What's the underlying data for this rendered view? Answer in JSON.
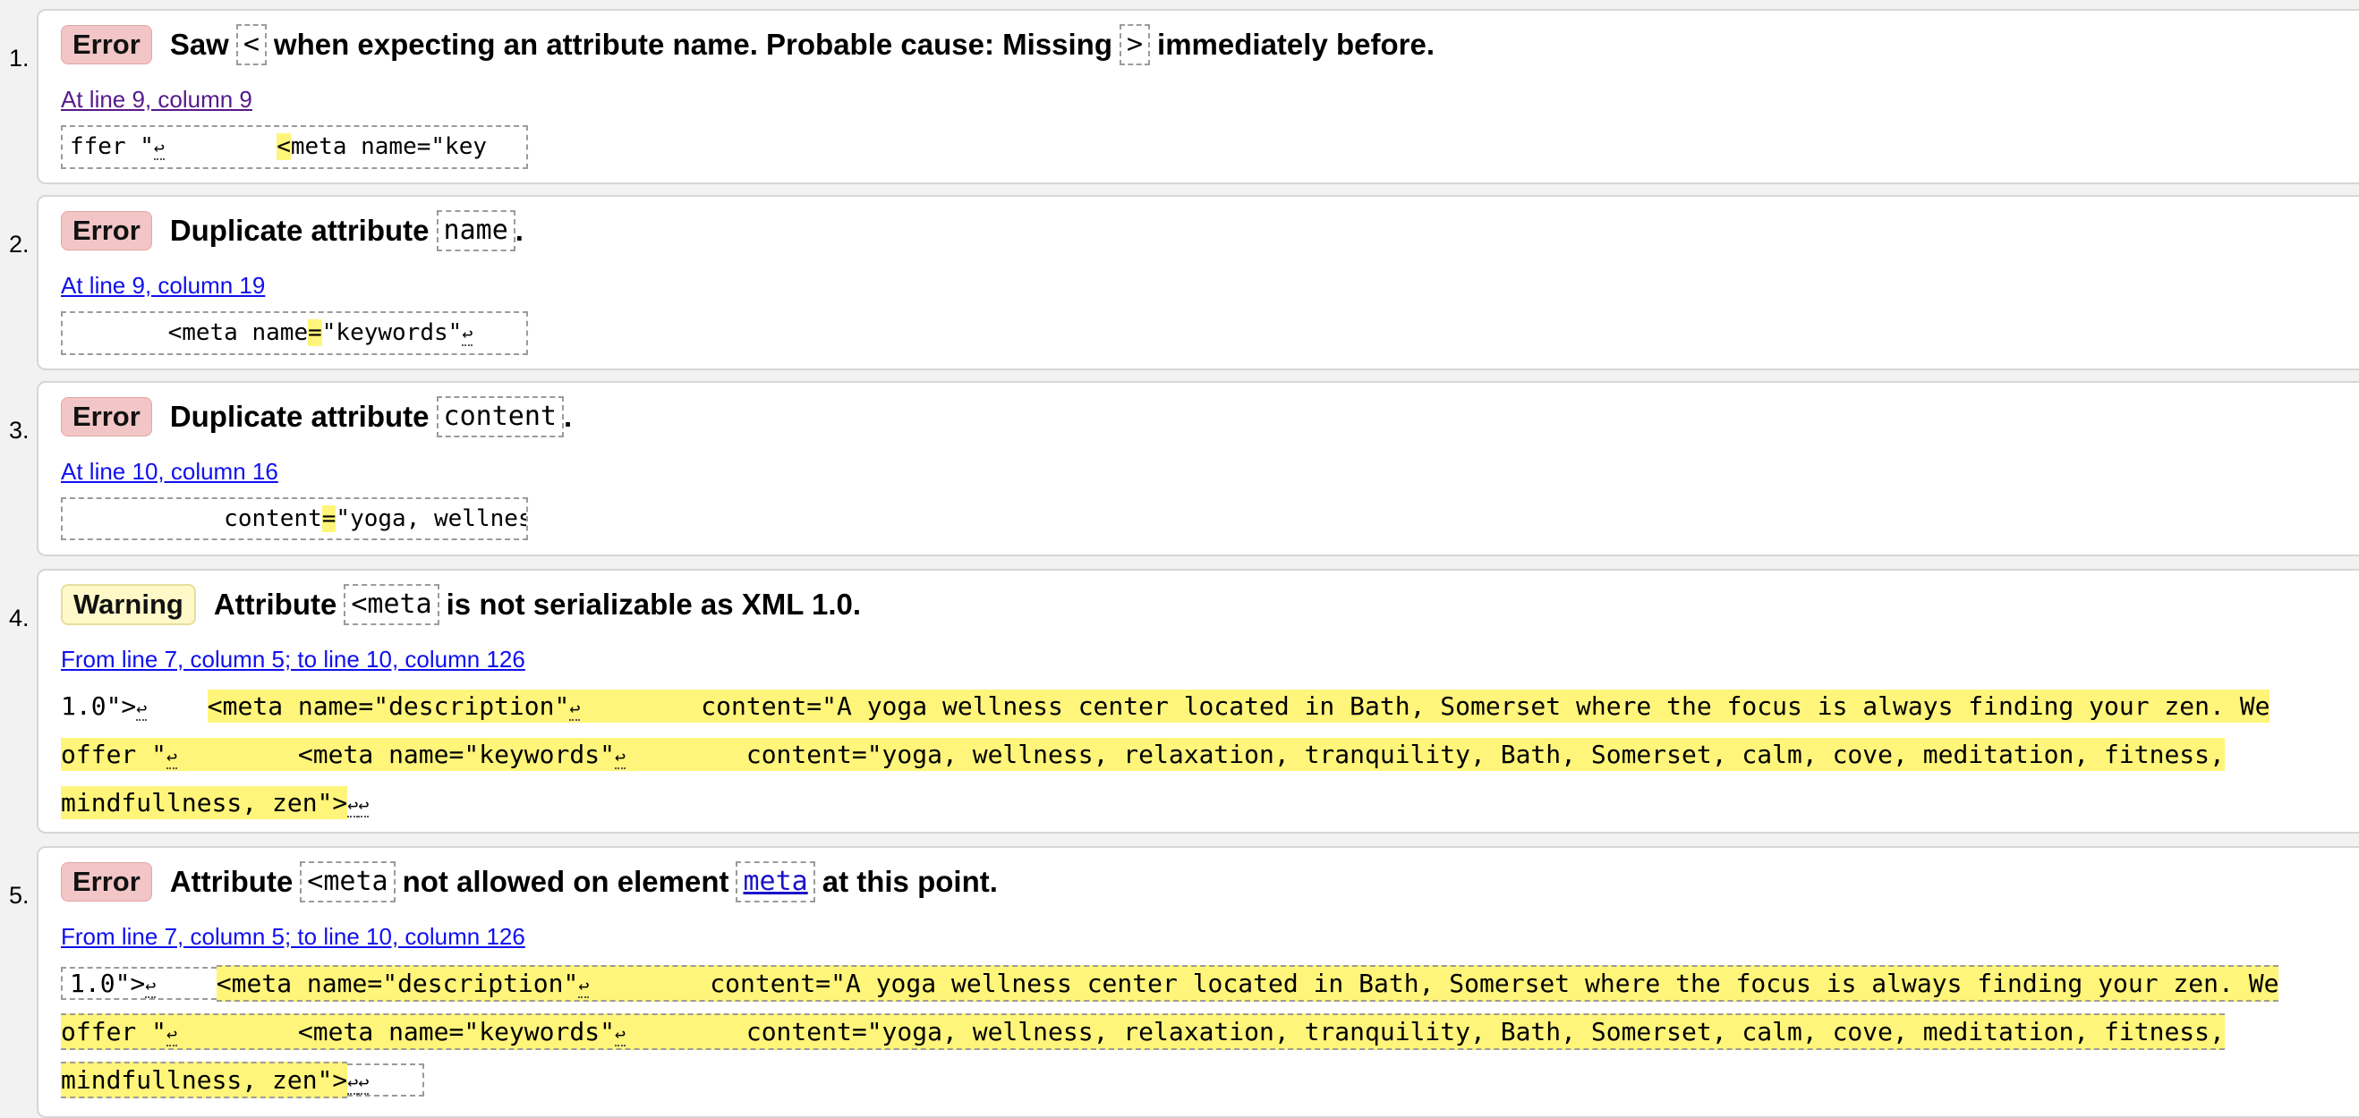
{
  "messages": [
    {
      "num": "1.",
      "type_label": "Error",
      "text_a": "Saw",
      "code_a": "<",
      "text_b": "when expecting an attribute name. Probable cause: Missing",
      "code_b": ">",
      "text_c": "immediately before.",
      "location": "At line 9, column 9",
      "extract_pre": "ffer \"",
      "extract_mid": "        ",
      "extract_hl": "<",
      "extract_post": "meta name=\"key"
    },
    {
      "num": "2.",
      "type_label": "Error",
      "text_a": "Duplicate attribute",
      "code_a": "name",
      "text_b": ".",
      "location": "At line 9, column 19",
      "extract_pre": "       <meta name",
      "extract_hl": "=",
      "extract_post": "\"keywords\""
    },
    {
      "num": "3.",
      "type_label": "Error",
      "text_a": "Duplicate attribute",
      "code_a": "content",
      "text_b": ".",
      "location": "At line 10, column 16",
      "extract_pre": "           content",
      "extract_hl": "=",
      "extract_post": "\"yoga, wellnes"
    },
    {
      "num": "4.",
      "type_label": "Warning",
      "text_a": "Attribute",
      "code_a": "<meta",
      "text_b": "is not serializable as XML 1.0.",
      "location": "From line 7, column 5; to line 10, column 126",
      "line1_pre": "1.0\">",
      "line1_hl": "<meta name=\"description\"",
      "line1_hl2": "        content=\"A yoga wellness center located in Bath, Somerset where the focus is always finding your zen. We",
      "line2_hl": "offer \"",
      "line2_hl2": "        <meta name=\"keywords\"",
      "line2_hl3": "        content=\"yoga, wellness, relaxation, tranquility, Bath, Somerset, calm, cove, meditation, fitness,",
      "line3_hl": "mindfullness, zen\">"
    },
    {
      "num": "5.",
      "type_label": "Error",
      "text_a": "Attribute",
      "code_a": "<meta",
      "text_b": "not allowed on element",
      "code_b": "meta",
      "text_c": "at this point.",
      "location": "From line 7, column 5; to line 10, column 126",
      "line1_pre": "1.0\">",
      "line1_hl": "<meta name=\"description\"",
      "line1_hl2": "        content=\"A yoga wellness center located in Bath, Somerset where the focus is always finding your zen. We",
      "line2_hl": "offer \"",
      "line2_hl2": "        <meta name=\"keywords\"",
      "line2_hl3": "        content=\"yoga, wellness, relaxation, tranquility, Bath, Somerset, calm, cove, meditation, fitness,",
      "line3_hl": "mindfullness, zen\">"
    }
  ],
  "return_glyph": "↩",
  "colors": {
    "error_badge": "#f2c6c6",
    "warning_badge": "#fff9c9",
    "highlight": "#fff57a",
    "link": "#1010ee",
    "visited_link": "#551a8b"
  }
}
